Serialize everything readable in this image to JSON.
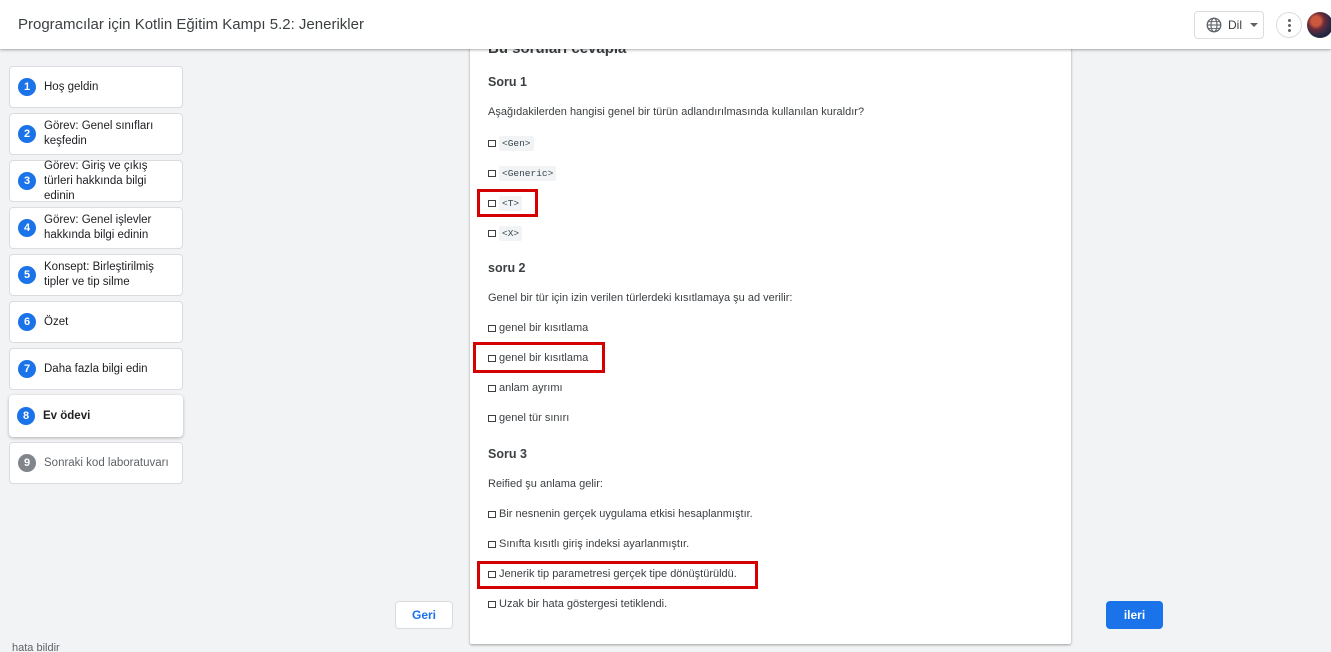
{
  "header": {
    "title": "Programcılar için Kotlin Eğitim Kampı 5.2: Jenerikler",
    "language_label": "Dil"
  },
  "sidebar": {
    "steps": [
      {
        "num": "1",
        "label": "Hoş geldin"
      },
      {
        "num": "2",
        "label": "Görev: Genel sınıfları keşfedin"
      },
      {
        "num": "3",
        "label": "Görev: Giriş ve çıkış türleri hakkında bilgi edinin"
      },
      {
        "num": "4",
        "label": "Görev: Genel işlevler hakkında bilgi edinin"
      },
      {
        "num": "5",
        "label": "Konsept: Birleştirilmiş tipler ve tip silme"
      },
      {
        "num": "6",
        "label": "Özet"
      },
      {
        "num": "7",
        "label": "Daha fazla bilgi edin"
      },
      {
        "num": "8",
        "label": "Ev ödevi"
      },
      {
        "num": "9",
        "label": "Sonraki kod laboratuvarı"
      }
    ],
    "report_link": "hata bildir"
  },
  "nav": {
    "back_label": "Geri",
    "next_label": "ileri"
  },
  "content": {
    "section_title": "Bu soruları cevapla",
    "q1": {
      "title": "Soru 1",
      "text": "Aşağıdakilerden hangisi genel bir türün adlandırılmasında kullanılan kuraldır?",
      "options": [
        "<Gen>",
        "<Generic>",
        "<T>",
        "<X>"
      ]
    },
    "q2": {
      "title": "soru 2",
      "text": "Genel bir tür için izin verilen türlerdeki kısıtlamaya şu ad verilir:",
      "options": [
        "genel bir kısıtlama",
        "genel bir kısıtlama",
        "anlam ayrımı",
        "genel tür sınırı"
      ]
    },
    "q3": {
      "title": "Soru 3",
      "text": "Reified şu anlama gelir:",
      "options": [
        "Bir nesnenin gerçek uygulama etkisi hesaplanmıştır.",
        "Sınıfta kısıtlı giriş indeksi ayarlanmıştır.",
        "Jenerik tip parametresi gerçek tipe dönüştürüldü.",
        "Uzak bir hata göstergesi tetiklendi."
      ]
    }
  },
  "colors": {
    "accent": "#1a73e8",
    "highlight": "#d50000",
    "muted_step": "#80868b"
  }
}
